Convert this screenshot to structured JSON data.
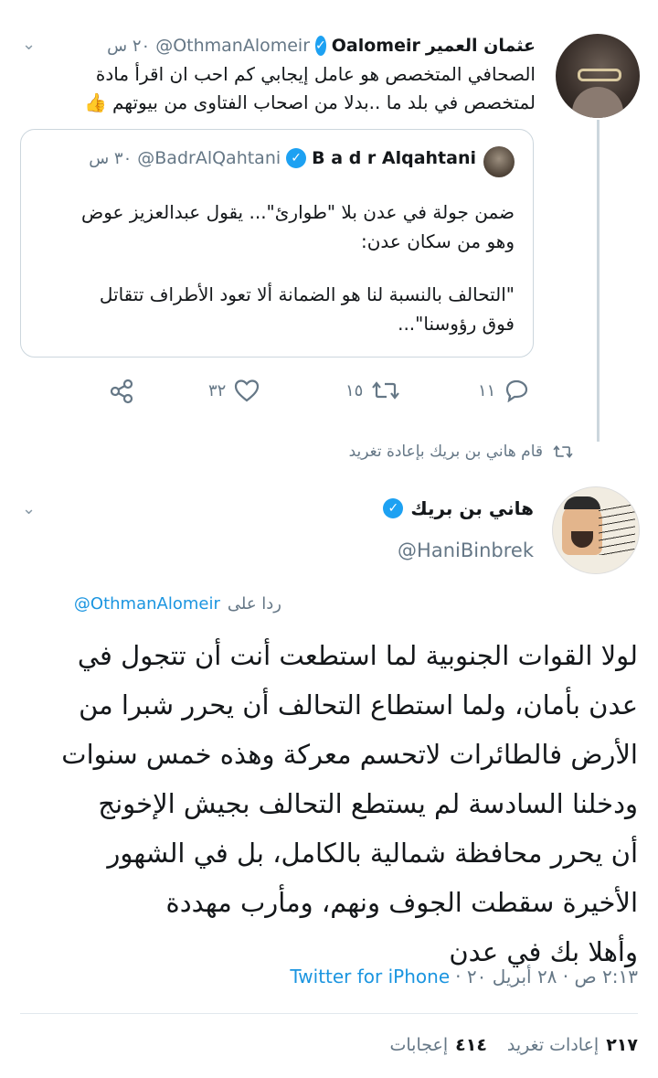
{
  "reply_tweet": {
    "display_name": "عثمان العمير",
    "handle_name": "Oalomeir",
    "username": "@OthmanAlomeir",
    "time": "٢٠ س",
    "text_line1": "الصحافي المتخصص هو عامل إيجابي  كم احب ان اقرأ مادة",
    "text_line2": "لمتخصص في بلد ما ..بدلا من اصحاب الفتاوى من بيوتهم",
    "emoji": "👍"
  },
  "quoted_tweet": {
    "display_name": "B a d r Alqahtani",
    "username": "@BadrAlQahtani",
    "time": "٣٠ س",
    "text_line1": "ضمن جولة في عدن بلا \"طوارئ\"... يقول عبدالعزيز عوض",
    "text_line2": "وهو من سكان عدن:",
    "text_line3": "\"التحالف بالنسبة لنا هو الضمانة ألا تعود الأطراف تتقاتل",
    "text_line4": "فوق رؤوسنا\"..."
  },
  "actions": {
    "reply_count": "١١",
    "retweet_count": "١٥",
    "like_count": "٣٢"
  },
  "retweet_note": "قام هاني بن بريك بإعادة تغريد",
  "main_tweet": {
    "display_name": "هاني بن بريك",
    "username": "@HaniBinbrek",
    "replying_prefix": "ردا على",
    "replying_to": "@OthmanAlomeir",
    "lines": [
      "لولا القوات الجنوبية لما استطعت أنت أن تتجول في",
      "عدن بأمان، ولما استطاع التحالف أن يحرر شبرا من",
      "الأرض فالطائرات لاتحسم معركة وهذه خمس سنوات",
      "ودخلنا السادسة لم يستطع التحالف بجيش الإخونج",
      "أن يحرر محافظة شمالية بالكامل، بل في الشهور",
      "الأخيرة سقطت الجوف ونهم، ومأرب مهددة",
      "وأهلا بك في عدن"
    ],
    "timestamp": "٢:١٣ ص · ٢٨ أبريل ٢٠ ·",
    "source": "Twitter for iPhone"
  },
  "stats": {
    "retweets_count": "٢١٧",
    "retweets_label": "إعادات تغريد",
    "likes_count": "٤١٤",
    "likes_label": "إعجابات"
  }
}
